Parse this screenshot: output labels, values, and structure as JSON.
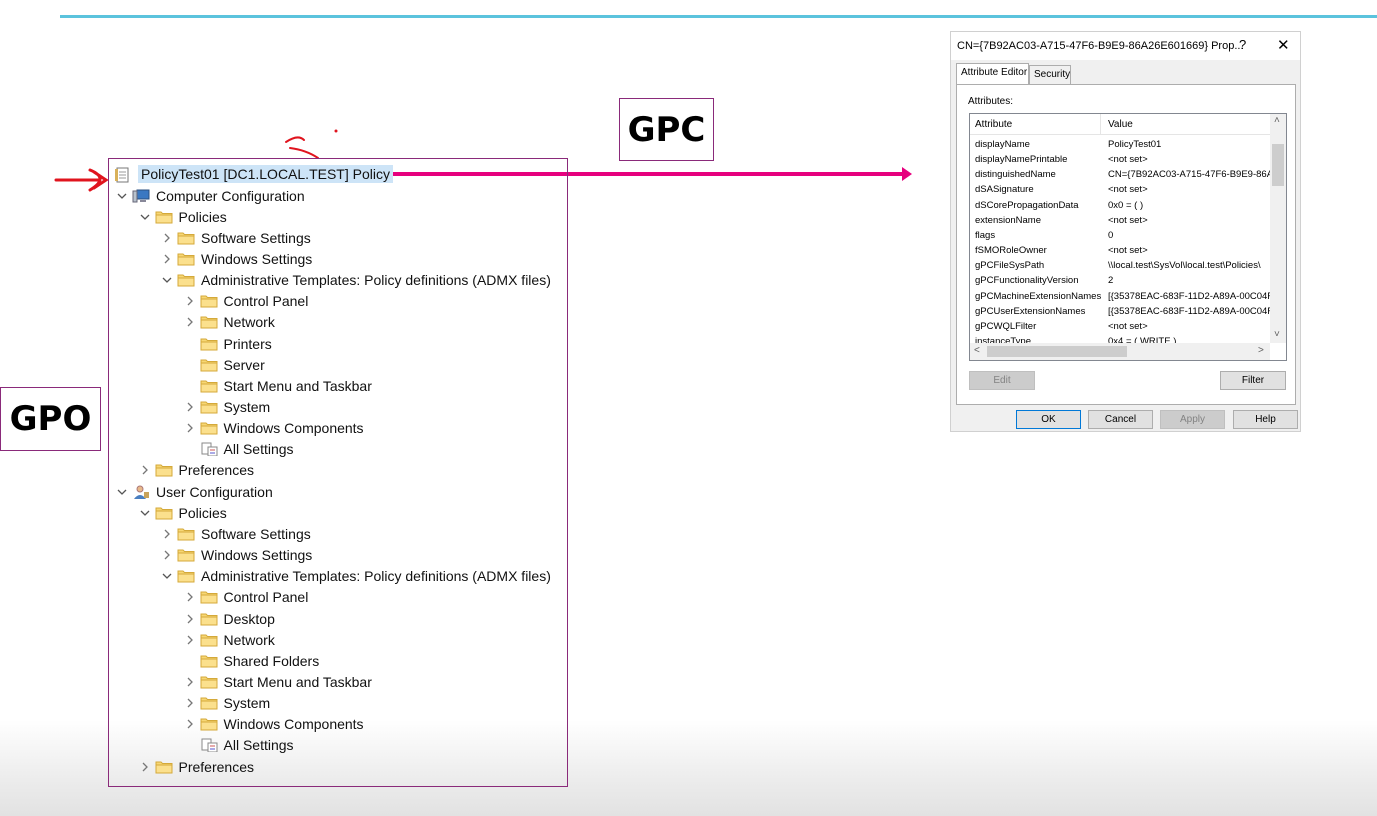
{
  "annotations": {
    "gpc_label": "GPC",
    "gpo_label": "GPO"
  },
  "tree": {
    "root": "PolicyTest01 [DC1.LOCAL.TEST] Policy",
    "rows": [
      {
        "label": "Computer Configuration",
        "icon": "computer-icon",
        "chevron": "down"
      },
      {
        "label": "Policies",
        "icon": "folder-icon",
        "chevron": "down"
      },
      {
        "label": "Software Settings",
        "icon": "folder-icon",
        "chevron": "right"
      },
      {
        "label": "Windows Settings",
        "icon": "folder-icon",
        "chevron": "right"
      },
      {
        "label": "Administrative Templates: Policy definitions (ADMX files)",
        "icon": "folder-icon",
        "chevron": "down"
      },
      {
        "label": "Control Panel",
        "icon": "folder-icon",
        "chevron": "right"
      },
      {
        "label": "Network",
        "icon": "folder-icon",
        "chevron": "right"
      },
      {
        "label": "Printers",
        "icon": "folder-icon",
        "chevron": "none"
      },
      {
        "label": "Server",
        "icon": "folder-icon",
        "chevron": "none"
      },
      {
        "label": "Start Menu and Taskbar",
        "icon": "folder-icon",
        "chevron": "none"
      },
      {
        "label": "System",
        "icon": "folder-icon",
        "chevron": "right"
      },
      {
        "label": "Windows Components",
        "icon": "folder-icon",
        "chevron": "right"
      },
      {
        "label": "All Settings",
        "icon": "settings-list-icon",
        "chevron": "none"
      },
      {
        "label": "Preferences",
        "icon": "folder-icon",
        "chevron": "right"
      },
      {
        "label": "User Configuration",
        "icon": "user-icon",
        "chevron": "down"
      },
      {
        "label": "Policies",
        "icon": "folder-icon",
        "chevron": "down"
      },
      {
        "label": "Software Settings",
        "icon": "folder-icon",
        "chevron": "right"
      },
      {
        "label": "Windows Settings",
        "icon": "folder-icon",
        "chevron": "right"
      },
      {
        "label": "Administrative Templates: Policy definitions (ADMX files)",
        "icon": "folder-icon",
        "chevron": "down"
      },
      {
        "label": "Control Panel",
        "icon": "folder-icon",
        "chevron": "right"
      },
      {
        "label": "Desktop",
        "icon": "folder-icon",
        "chevron": "right"
      },
      {
        "label": "Network",
        "icon": "folder-icon",
        "chevron": "right"
      },
      {
        "label": "Shared Folders",
        "icon": "folder-icon",
        "chevron": "none"
      },
      {
        "label": "Start Menu and Taskbar",
        "icon": "folder-icon",
        "chevron": "right"
      },
      {
        "label": "System",
        "icon": "folder-icon",
        "chevron": "right"
      },
      {
        "label": "Windows Components",
        "icon": "folder-icon",
        "chevron": "right"
      },
      {
        "label": "All Settings",
        "icon": "settings-list-icon",
        "chevron": "none"
      },
      {
        "label": "Preferences",
        "icon": "folder-icon",
        "chevron": "right"
      }
    ]
  },
  "dialog": {
    "title": "CN={7B92AC03-A715-47F6-B9E9-86A26E601669} Prop...",
    "help": "?",
    "close": "✕",
    "tabs": [
      "Attribute Editor",
      "Security"
    ],
    "attributes_label": "Attributes:",
    "columns": [
      "Attribute",
      "Value"
    ],
    "rows": [
      {
        "attribute": "displayName",
        "value": "PolicyTest01"
      },
      {
        "attribute": "displayNamePrintable",
        "value": "<not set>"
      },
      {
        "attribute": "distinguishedName",
        "value": "CN={7B92AC03-A715-47F6-B9E9-86A"
      },
      {
        "attribute": "dSASignature",
        "value": "<not set>"
      },
      {
        "attribute": "dSCorePropagationData",
        "value": "0x0 = ( )"
      },
      {
        "attribute": "extensionName",
        "value": "<not set>"
      },
      {
        "attribute": "flags",
        "value": "0"
      },
      {
        "attribute": "fSMORoleOwner",
        "value": "<not set>"
      },
      {
        "attribute": "gPCFileSysPath",
        "value": "\\\\local.test\\SysVol\\local.test\\Policies\\"
      },
      {
        "attribute": "gPCFunctionalityVersion",
        "value": "2"
      },
      {
        "attribute": "gPCMachineExtensionNames",
        "value": "[{35378EAC-683F-11D2-A89A-00C04F"
      },
      {
        "attribute": "gPCUserExtensionNames",
        "value": "[{35378EAC-683F-11D2-A89A-00C04F"
      },
      {
        "attribute": "gPCWQLFilter",
        "value": "<not set>"
      },
      {
        "attribute": "instanceType",
        "value": "0x4 = ( WRITE )"
      }
    ],
    "buttons": {
      "edit": "Edit",
      "filter": "Filter",
      "ok": "OK",
      "cancel": "Cancel",
      "apply": "Apply",
      "help": "Help"
    }
  },
  "colors": {
    "arrow": "#e6007e",
    "frame": "#8a2a7a",
    "top_line": "#5bc3dd",
    "selection": "#cde4f7"
  }
}
